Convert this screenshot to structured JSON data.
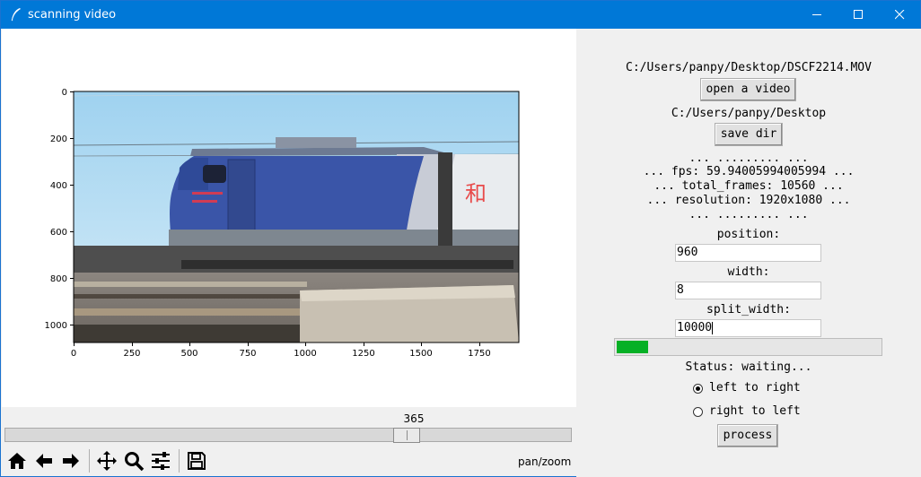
{
  "window": {
    "title": "scanning video",
    "icon": "feather-icon",
    "controls": [
      "minimize-icon",
      "maximize-icon",
      "close-icon"
    ]
  },
  "figure": {
    "image_description_icon": "video-frame-image",
    "y_ticks": [
      "0",
      "200",
      "400",
      "600",
      "800",
      "1000"
    ],
    "x_ticks": [
      "0",
      "250",
      "500",
      "750",
      "1000",
      "1250",
      "1500",
      "1750"
    ],
    "overlay_text": "和"
  },
  "slider": {
    "value": "365",
    "fraction": 0.72
  },
  "toolbar": {
    "tools": [
      "home-icon",
      "back-arrow-icon",
      "forward-arrow-icon",
      "pan-icon",
      "zoom-icon",
      "configure-subplots-icon",
      "save-icon"
    ],
    "status": "pan/zoom"
  },
  "panel": {
    "video_path": "C:/Users/panpy/Desktop/DSCF2214.MOV",
    "open_button": "open a video",
    "save_dir_path": "C:/Users/panpy/Desktop",
    "save_dir_button": "save dir",
    "info_sep_top": "... ......... ...",
    "fps_line": "... fps: 59.94005994005994 ...",
    "frames_line": "... total_frames: 10560 ...",
    "resolution_line": "... resolution: 1920x1080 ...",
    "info_sep_bottom": "... ......... ...",
    "position_label": "position:",
    "position_value": "960",
    "width_label": "width:",
    "width_value": "8",
    "split_width_label": "split_width:",
    "split_width_value": "10000",
    "progress": 0.12,
    "status_text": "Status: waiting...",
    "direction_options": [
      "left to right",
      "right to left"
    ],
    "selected_direction": "left to right",
    "process_button": "process"
  },
  "colors": {
    "titlebar": "#0078d7",
    "progress_fill": "#06b025"
  }
}
